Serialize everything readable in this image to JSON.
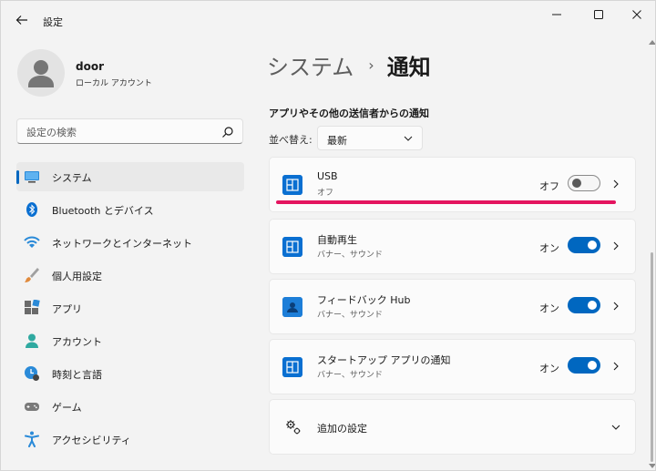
{
  "window": {
    "app_title": "設定",
    "controls": {
      "minimize": "minimize-icon",
      "maximize": "maximize-icon",
      "close": "close-icon"
    }
  },
  "profile": {
    "name": "door",
    "account_type": "ローカル アカウント"
  },
  "search": {
    "placeholder": "設定の検索",
    "value": ""
  },
  "sidebar": {
    "items": [
      {
        "label": "システム",
        "icon": "system-icon",
        "active": true
      },
      {
        "label": "Bluetooth とデバイス",
        "icon": "bluetooth-icon",
        "active": false
      },
      {
        "label": "ネットワークとインターネット",
        "icon": "wifi-icon",
        "active": false
      },
      {
        "label": "個人用設定",
        "icon": "brush-icon",
        "active": false
      },
      {
        "label": "アプリ",
        "icon": "apps-icon",
        "active": false
      },
      {
        "label": "アカウント",
        "icon": "account-icon",
        "active": false
      },
      {
        "label": "時刻と言語",
        "icon": "clock-icon",
        "active": false
      },
      {
        "label": "ゲーム",
        "icon": "gamepad-icon",
        "active": false
      },
      {
        "label": "アクセシビリティ",
        "icon": "accessibility-icon",
        "active": false
      }
    ]
  },
  "breadcrumb": {
    "parent": "システム",
    "separator": "›",
    "current": "通知"
  },
  "section": {
    "title": "アプリやその他の送信者からの通知"
  },
  "sort": {
    "label": "並べ替え:",
    "selected": "最新"
  },
  "apps": [
    {
      "name": "USB",
      "subtitle": "オフ",
      "state": "オフ",
      "enabled": false
    },
    {
      "name": "自動再生",
      "subtitle": "バナー、サウンド",
      "state": "オン",
      "enabled": true
    },
    {
      "name": "フィードバック Hub",
      "subtitle": "バナー、サウンド",
      "state": "オン",
      "enabled": true
    },
    {
      "name": "スタートアップ アプリの通知",
      "subtitle": "バナー、サウンド",
      "state": "オン",
      "enabled": true
    }
  ],
  "additional": {
    "label": "追加の設定"
  },
  "colors": {
    "accent": "#0067c0",
    "highlight": "#e4145f",
    "background": "#f3f3f3"
  }
}
